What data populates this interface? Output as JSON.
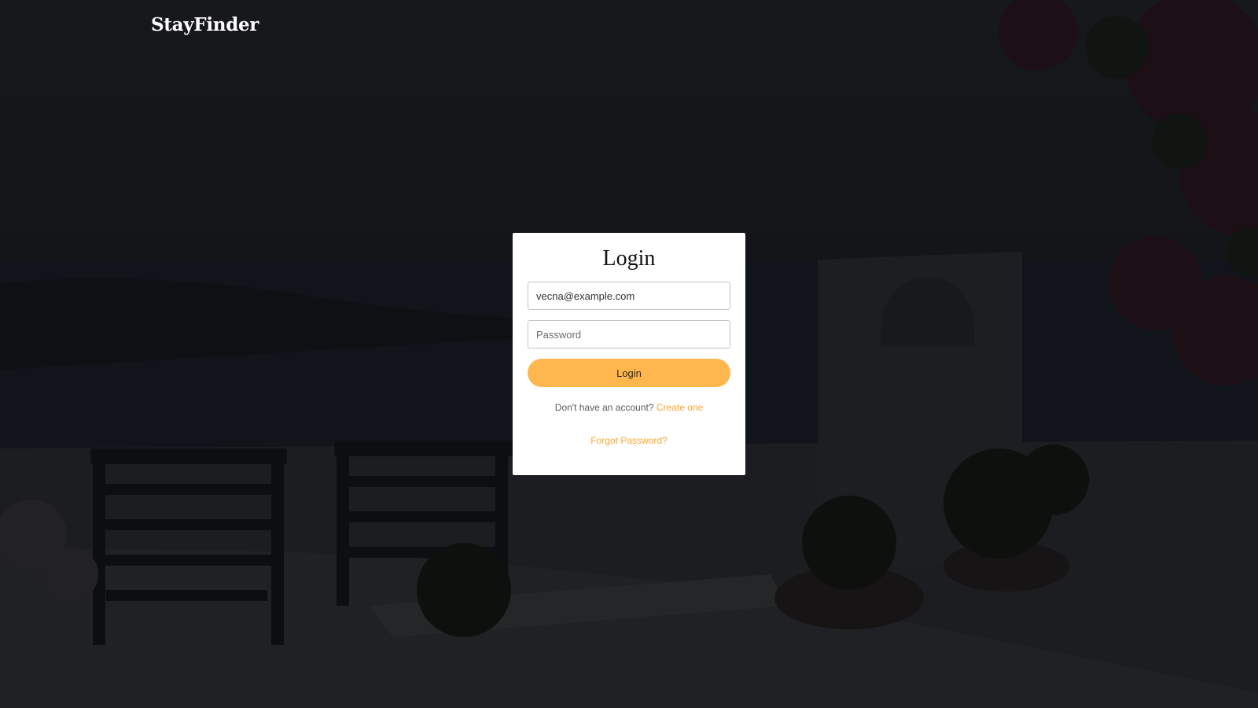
{
  "header": {
    "brand": "StayFinder"
  },
  "login_card": {
    "title": "Login",
    "email_field": {
      "value": "vecna@example.com",
      "placeholder": ""
    },
    "password_field": {
      "value": "",
      "placeholder": "Password"
    },
    "submit_label": "Login",
    "signup_prompt": "Don't have an account?",
    "signup_link": "Create one",
    "forgot_link": "Forgot Password?"
  },
  "colors": {
    "accent": "#ffb74d",
    "link": "#ffa630",
    "card_bg": "#ffffff",
    "overlay": "#0a0c0e"
  }
}
